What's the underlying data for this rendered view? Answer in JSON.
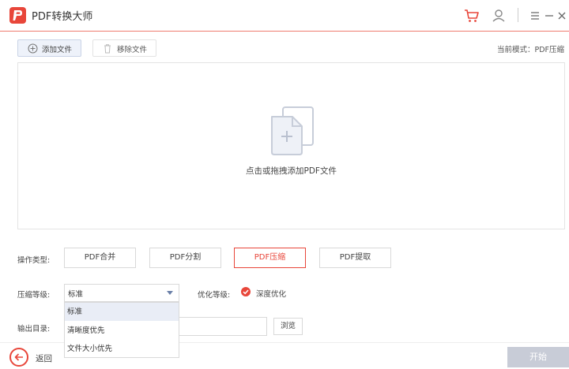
{
  "app": {
    "title": "PDF转换大师",
    "brand_color": "#e8463a"
  },
  "titlebar": {
    "icons": [
      "cart-icon",
      "user-icon",
      "menu-icon",
      "minimize-icon",
      "close-icon"
    ]
  },
  "toolbar": {
    "add_label": "添加文件",
    "remove_label": "移除文件",
    "mode_label": "当前模式：PDF压缩"
  },
  "dropzone": {
    "text": "点击或拖拽添加PDF文件"
  },
  "operation": {
    "label": "操作类型:",
    "buttons": [
      {
        "label": "PDF合并",
        "active": false
      },
      {
        "label": "PDF分割",
        "active": false
      },
      {
        "label": "PDF压缩",
        "active": true
      },
      {
        "label": "PDF提取",
        "active": false
      }
    ]
  },
  "compression": {
    "label": "压缩等级:",
    "selected": "标准",
    "options": [
      "标准",
      "清晰度优先",
      "文件大小优先"
    ]
  },
  "optimize": {
    "label": "优化等级:",
    "option_label": "深度优化",
    "checked": true
  },
  "output": {
    "label": "输出目录:",
    "path": "",
    "browse_label": "浏览"
  },
  "footer": {
    "back_label": "返回",
    "start_label": "开始"
  }
}
